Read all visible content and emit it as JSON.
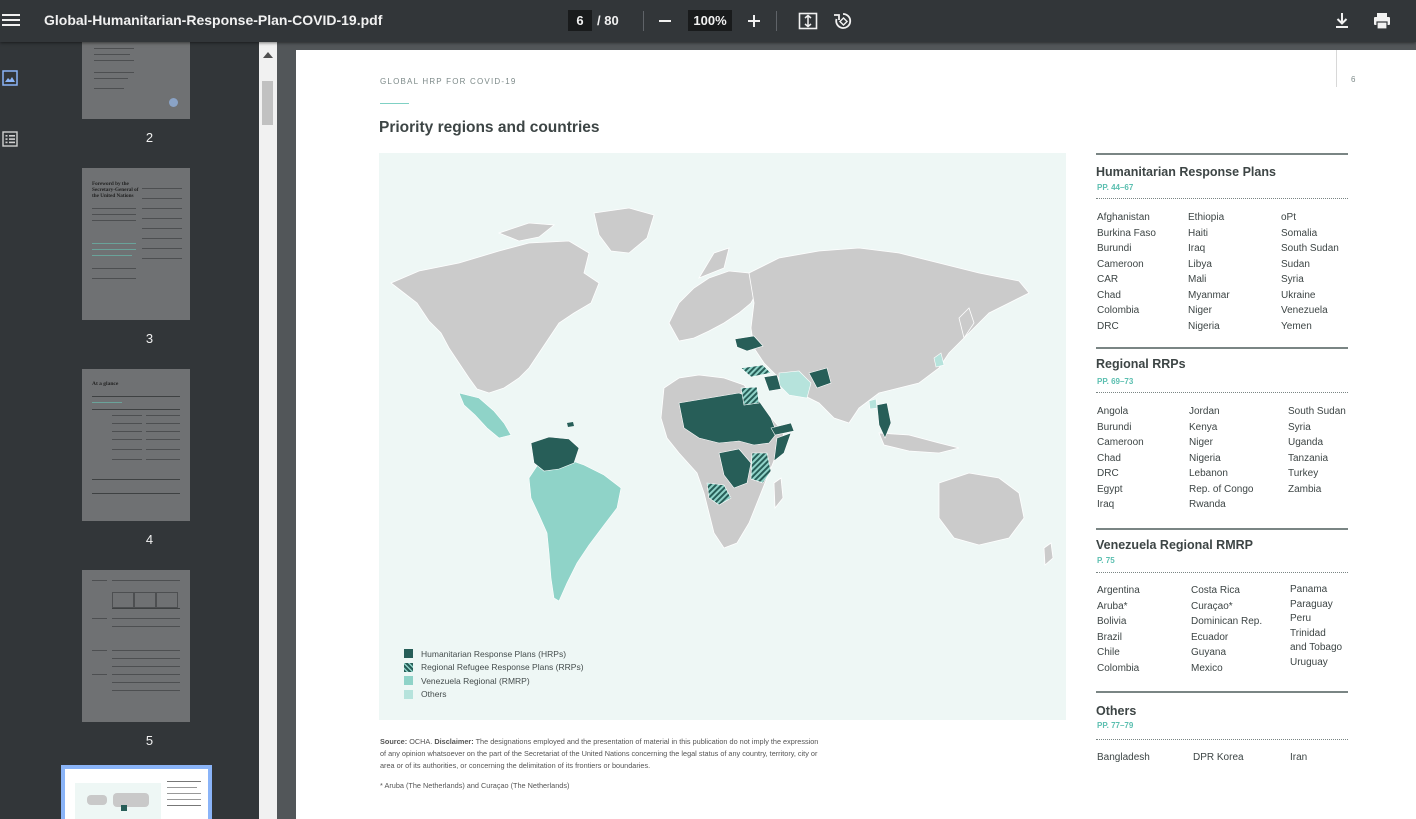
{
  "toolbar": {
    "file_name": "Global-Humanitarian-Response-Plan-COVID-19.pdf",
    "current_page": "6",
    "total_pages": "/ 80",
    "zoom": "100%",
    "icons": [
      "menu-icon",
      "zoom-out-icon",
      "zoom-in-icon",
      "fit-page-icon",
      "rotate-icon",
      "download-icon",
      "print-icon"
    ]
  },
  "sidebar": {
    "rail_icons": [
      "thumbnails-icon",
      "outline-icon"
    ],
    "thumbnails": [
      {
        "label": "2"
      },
      {
        "label": "3",
        "heading": "Foreword by the Secretary-General of the United Nations"
      },
      {
        "label": "4",
        "heading": "At a glance"
      },
      {
        "label": "5"
      },
      {
        "label": "6",
        "selected": true
      }
    ]
  },
  "page": {
    "running_head": "GLOBAL HRP FOR COVID-19",
    "page_number": "6",
    "title": "Priority regions and countries",
    "legend": [
      {
        "label": "Humanitarian Response Plans (HRPs)",
        "color": "#275e58",
        "pattern": "solid"
      },
      {
        "label": "Regional Refugee Response Plans (RRPs)",
        "color": "#275e58",
        "pattern": "hatch"
      },
      {
        "label": "Venezuela Regional (RMRP)",
        "color": "#8fd3c8",
        "pattern": "solid"
      },
      {
        "label": "Others",
        "color": "#b6e3dc",
        "pattern": "solid"
      }
    ],
    "source_label": "Source:",
    "source_org": "OCHA.",
    "disclaimer_label": "Disclaimer:",
    "disclaimer_text": "The designations employed and the presentation of material in this publication do not imply the expression of any opinion whatsoever on the part of the Secretariat of the United Nations concerning the legal status of any country, territory, city or area or of its authorities, or concerning the delimitation of its frontiers or boundaries.",
    "footnote": "* Aruba (The Netherlands) and Curaçao (The Netherlands)",
    "sections": {
      "hrp": {
        "title": "Humanitarian Response Plans",
        "pages": "PP. 44–67",
        "columns": [
          [
            "Afghanistan",
            "Burkina Faso",
            "Burundi",
            "Cameroon",
            "CAR",
            "Chad",
            "Colombia",
            "DRC"
          ],
          [
            "Ethiopia",
            "Haiti",
            "Iraq",
            "Libya",
            "Mali",
            "Myanmar",
            "Niger",
            "Nigeria"
          ],
          [
            "oPt",
            "Somalia",
            "South Sudan",
            "Sudan",
            "Syria",
            "Ukraine",
            "Venezuela",
            "Yemen"
          ]
        ]
      },
      "rrp": {
        "title": "Regional RRPs",
        "pages": "PP. 69–73",
        "columns": [
          [
            "Angola",
            "Burundi",
            "Cameroon",
            "Chad",
            "DRC",
            "Egypt",
            "Iraq"
          ],
          [
            "Jordan",
            "Kenya",
            "Niger",
            "Nigeria",
            "Lebanon",
            "Rep. of Congo",
            "Rwanda"
          ],
          [
            "South Sudan",
            "Syria",
            "Uganda",
            "Tanzania",
            "Turkey",
            "Zambia"
          ]
        ]
      },
      "rmrp": {
        "title": "Venezuela Regional RMRP",
        "pages": "P. 75",
        "columns": [
          [
            "Argentina",
            "Aruba*",
            "Bolivia",
            "Brazil",
            "Chile",
            "Colombia"
          ],
          [
            "Costa Rica",
            "Curaçao*",
            "Dominican Rep.",
            "Ecuador",
            "Guyana",
            "Mexico"
          ],
          [
            "Panama",
            "Paraguay",
            "Peru",
            "Trinidad",
            "and Tobago",
            "Uruguay"
          ]
        ]
      },
      "others": {
        "title": "Others",
        "pages": "PP. 77–79",
        "columns": [
          [
            "Bangladesh"
          ],
          [
            "DPR Korea"
          ],
          [
            "Iran"
          ]
        ]
      }
    }
  }
}
